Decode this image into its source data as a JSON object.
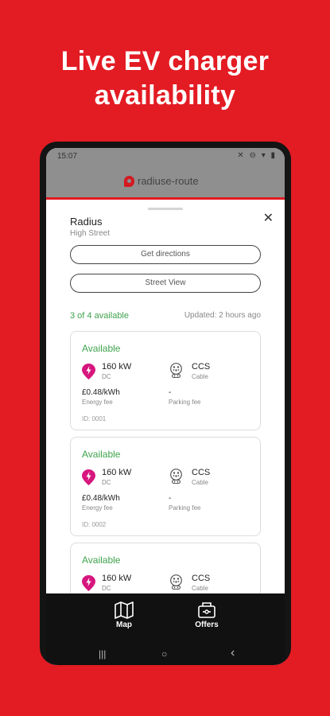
{
  "headline": {
    "line1": "Live EV charger",
    "line2": "availability"
  },
  "statusbar": {
    "time": "15:07",
    "icons": "✕ ⊖ ▾ ▮"
  },
  "appbar": {
    "logo_text": "radiuse-route"
  },
  "station": {
    "name": "Radius",
    "street": "High Street",
    "close_glyph": "✕"
  },
  "actions": {
    "directions_label": "Get directions",
    "streetview_label": "Street View"
  },
  "summary": {
    "available_text": "3 of 4 available",
    "updated_text": "Updated: 2 hours ago"
  },
  "chargers": [
    {
      "status": "Available",
      "power": "160 kW",
      "current": "DC",
      "connector": "CCS",
      "connector_sub": "Cable",
      "energy_price": "£0.48/kWh",
      "energy_label": "Energy fee",
      "parking_price": "-",
      "parking_label": "Parking fee",
      "id": "ID: 0001"
    },
    {
      "status": "Available",
      "power": "160 kW",
      "current": "DC",
      "connector": "CCS",
      "connector_sub": "Cable",
      "energy_price": "£0.48/kWh",
      "energy_label": "Energy fee",
      "parking_price": "-",
      "parking_label": "Parking fee",
      "id": "ID: 0002"
    },
    {
      "status": "Available",
      "power": "160 kW",
      "current": "DC",
      "connector": "CCS",
      "connector_sub": "Cable"
    }
  ],
  "bottom_nav": {
    "map_label": "Map",
    "offers_label": "Offers"
  },
  "system_nav": {
    "recents": "|||",
    "home": "○",
    "back": "‹"
  },
  "colors": {
    "brand_red": "#e31b23",
    "available_green": "#3fa34d",
    "bolt_pink": "#d6167e"
  }
}
